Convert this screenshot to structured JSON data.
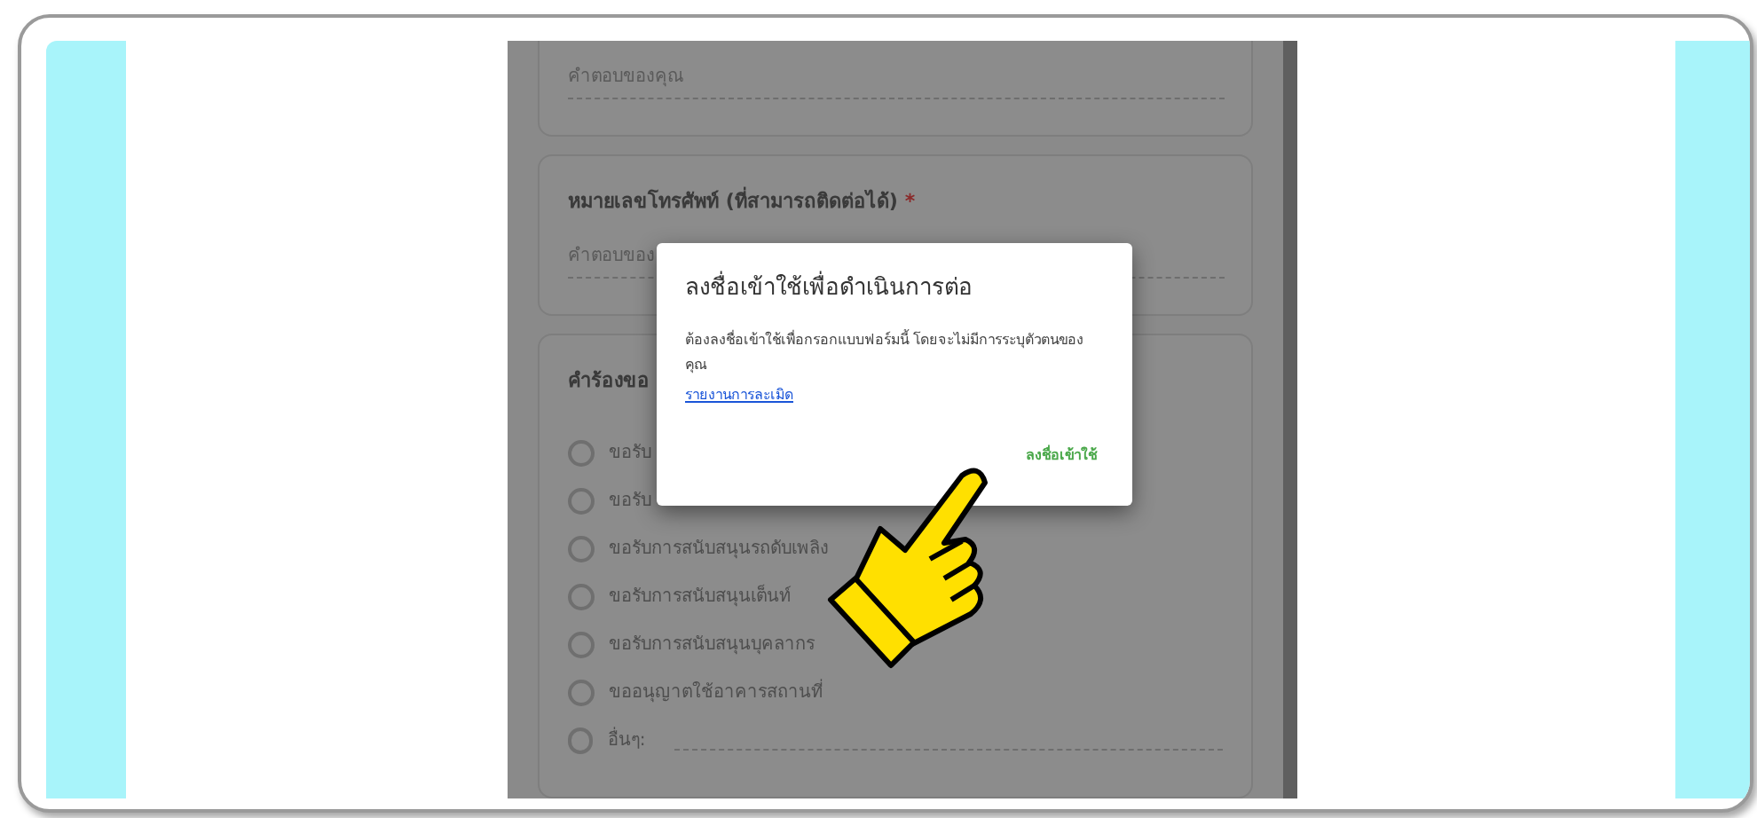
{
  "form": {
    "cards": [
      {
        "kind": "text_answer",
        "answer_placeholder": "คำตอบของคุณ"
      },
      {
        "kind": "text_answer",
        "question": "หมายเลขโทรศัพท์ (ที่สามารถติดต่อได้)",
        "required_mark": "*",
        "answer_placeholder": "คำตอบของ"
      },
      {
        "kind": "choice",
        "question": "คำร้องขอ",
        "options": [
          {
            "label": "ขอรับ",
            "selected": false
          },
          {
            "label": "ขอรับ",
            "selected": false
          },
          {
            "label": "ขอรับการสนับสนุนรถดับเพลิง",
            "selected": false
          },
          {
            "label": "ขอรับการสนับสนุนเต็นท์",
            "selected": false
          },
          {
            "label": "ขอรับการสนับสนุนบุคลากร",
            "selected": false
          },
          {
            "label": "ขออนุญาตใช้อาคารสถานที่",
            "selected": false
          },
          {
            "label": "อื่นๆ:",
            "selected": false,
            "kind": "other"
          }
        ]
      }
    ]
  },
  "dialog": {
    "title": "ลงชื่อเข้าใช้เพื่อดำเนินการต่อ",
    "message": "ต้องลงชื่อเข้าใช้เพื่อกรอกแบบฟอร์มนี้ โดยจะไม่มีการระบุตัวตนของคุณ",
    "link": "รายงานการละเมิด",
    "button": "ลงชื่อเข้าใช้"
  }
}
